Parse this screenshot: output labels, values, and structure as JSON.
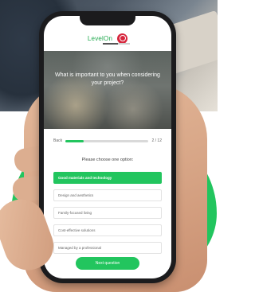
{
  "app": {
    "logo_text": "LevelOn",
    "logo_icon": "red-circle-logo-icon"
  },
  "hero": {
    "question": "What is important to you when considering your project?"
  },
  "progress": {
    "back_label": "Back",
    "step_label": "2 / 12",
    "fraction": 0.22
  },
  "instruction": "Please choose one option:",
  "options": [
    {
      "label": "Good materials and technology",
      "selected": true
    },
    {
      "label": "Design and aesthetics",
      "selected": false
    },
    {
      "label": "Family-focused living",
      "selected": false
    },
    {
      "label": "Cost-effective solutions",
      "selected": false
    },
    {
      "label": "Managed by a professional",
      "selected": false
    }
  ],
  "next_button": "Next question",
  "colors": {
    "accent": "#22c55e",
    "logo": "#d7263d"
  }
}
